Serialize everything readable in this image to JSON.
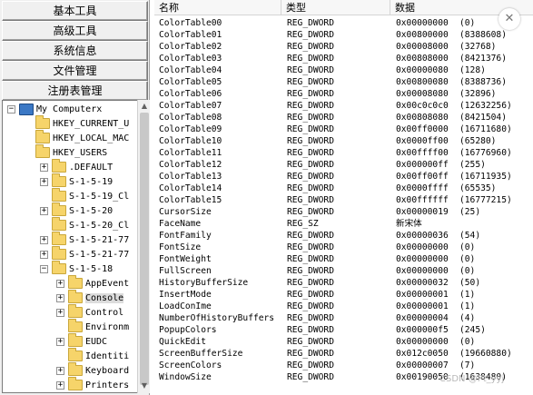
{
  "nav": [
    {
      "label": "基本工具"
    },
    {
      "label": "高级工具"
    },
    {
      "label": "系统信息"
    },
    {
      "label": "文件管理"
    },
    {
      "label": "注册表管理"
    }
  ],
  "tree": [
    {
      "label": "My Computerx",
      "depth": 0,
      "expander": "−",
      "icon": "computer-icon"
    },
    {
      "label": "HKEY_CURRENT_U",
      "depth": 1,
      "expander": "",
      "icon": "folder-icon"
    },
    {
      "label": "HKEY_LOCAL_MAC",
      "depth": 1,
      "expander": "",
      "icon": "folder-icon"
    },
    {
      "label": "HKEY_USERS",
      "depth": 1,
      "expander": "",
      "icon": "folder-icon"
    },
    {
      "label": ".DEFAULT",
      "depth": 2,
      "expander": "+",
      "icon": "folder-icon"
    },
    {
      "label": "S-1-5-19",
      "depth": 2,
      "expander": "+",
      "icon": "folder-icon"
    },
    {
      "label": "S-1-5-19_Cl",
      "depth": 2,
      "expander": "",
      "icon": "folder-icon"
    },
    {
      "label": "S-1-5-20",
      "depth": 2,
      "expander": "+",
      "icon": "folder-icon"
    },
    {
      "label": "S-1-5-20_Cl",
      "depth": 2,
      "expander": "",
      "icon": "folder-icon"
    },
    {
      "label": "S-1-5-21-77",
      "depth": 2,
      "expander": "+",
      "icon": "folder-icon"
    },
    {
      "label": "S-1-5-21-77",
      "depth": 2,
      "expander": "+",
      "icon": "folder-icon"
    },
    {
      "label": "S-1-5-18",
      "depth": 2,
      "expander": "−",
      "icon": "folder-icon"
    },
    {
      "label": "AppEvent",
      "depth": 3,
      "expander": "+",
      "icon": "folder-icon"
    },
    {
      "label": "Console",
      "depth": 3,
      "expander": "+",
      "icon": "folder-icon",
      "selected": true
    },
    {
      "label": "Control",
      "depth": 3,
      "expander": "+",
      "icon": "folder-icon"
    },
    {
      "label": "Environm",
      "depth": 3,
      "expander": "",
      "icon": "folder-icon"
    },
    {
      "label": "EUDC",
      "depth": 3,
      "expander": "+",
      "icon": "folder-icon"
    },
    {
      "label": "Identiti",
      "depth": 3,
      "expander": "",
      "icon": "folder-icon"
    },
    {
      "label": "Keyboard",
      "depth": 3,
      "expander": "+",
      "icon": "folder-icon"
    },
    {
      "label": "Printers",
      "depth": 3,
      "expander": "+",
      "icon": "folder-icon"
    }
  ],
  "columns": {
    "name": "名称",
    "type": "类型",
    "data": "数据"
  },
  "rows": [
    {
      "name": "ColorTable00",
      "type": "REG_DWORD",
      "hex": "0x00000000",
      "dec": "(0)"
    },
    {
      "name": "ColorTable01",
      "type": "REG_DWORD",
      "hex": "0x00800000",
      "dec": "(8388608)"
    },
    {
      "name": "ColorTable02",
      "type": "REG_DWORD",
      "hex": "0x00008000",
      "dec": "(32768)"
    },
    {
      "name": "ColorTable03",
      "type": "REG_DWORD",
      "hex": "0x00808000",
      "dec": "(8421376)"
    },
    {
      "name": "ColorTable04",
      "type": "REG_DWORD",
      "hex": "0x00000080",
      "dec": "(128)"
    },
    {
      "name": "ColorTable05",
      "type": "REG_DWORD",
      "hex": "0x00800080",
      "dec": "(8388736)"
    },
    {
      "name": "ColorTable06",
      "type": "REG_DWORD",
      "hex": "0x00008080",
      "dec": "(32896)"
    },
    {
      "name": "ColorTable07",
      "type": "REG_DWORD",
      "hex": "0x00c0c0c0",
      "dec": "(12632256)"
    },
    {
      "name": "ColorTable08",
      "type": "REG_DWORD",
      "hex": "0x00808080",
      "dec": "(8421504)"
    },
    {
      "name": "ColorTable09",
      "type": "REG_DWORD",
      "hex": "0x00ff0000",
      "dec": "(16711680)"
    },
    {
      "name": "ColorTable10",
      "type": "REG_DWORD",
      "hex": "0x0000ff00",
      "dec": "(65280)"
    },
    {
      "name": "ColorTable11",
      "type": "REG_DWORD",
      "hex": "0x00ffff00",
      "dec": "(16776960)"
    },
    {
      "name": "ColorTable12",
      "type": "REG_DWORD",
      "hex": "0x000000ff",
      "dec": "(255)"
    },
    {
      "name": "ColorTable13",
      "type": "REG_DWORD",
      "hex": "0x00ff00ff",
      "dec": "(16711935)"
    },
    {
      "name": "ColorTable14",
      "type": "REG_DWORD",
      "hex": "0x0000ffff",
      "dec": "(65535)"
    },
    {
      "name": "ColorTable15",
      "type": "REG_DWORD",
      "hex": "0x00ffffff",
      "dec": "(16777215)"
    },
    {
      "name": "CursorSize",
      "type": "REG_DWORD",
      "hex": "0x00000019",
      "dec": "(25)"
    },
    {
      "name": "FaceName",
      "type": "REG_SZ",
      "hex": "新宋体",
      "dec": ""
    },
    {
      "name": "FontFamily",
      "type": "REG_DWORD",
      "hex": "0x00000036",
      "dec": "(54)"
    },
    {
      "name": "FontSize",
      "type": "REG_DWORD",
      "hex": "0x00000000",
      "dec": "(0)"
    },
    {
      "name": "FontWeight",
      "type": "REG_DWORD",
      "hex": "0x00000000",
      "dec": "(0)"
    },
    {
      "name": "FullScreen",
      "type": "REG_DWORD",
      "hex": "0x00000000",
      "dec": "(0)"
    },
    {
      "name": "HistoryBufferSize",
      "type": "REG_DWORD",
      "hex": "0x00000032",
      "dec": "(50)"
    },
    {
      "name": "InsertMode",
      "type": "REG_DWORD",
      "hex": "0x00000001",
      "dec": "(1)"
    },
    {
      "name": "LoadConIme",
      "type": "REG_DWORD",
      "hex": "0x00000001",
      "dec": "(1)"
    },
    {
      "name": "NumberOfHistoryBuffers",
      "type": "REG_DWORD",
      "hex": "0x00000004",
      "dec": "(4)"
    },
    {
      "name": "PopupColors",
      "type": "REG_DWORD",
      "hex": "0x000000f5",
      "dec": "(245)"
    },
    {
      "name": "QuickEdit",
      "type": "REG_DWORD",
      "hex": "0x00000000",
      "dec": "(0)"
    },
    {
      "name": "ScreenBufferSize",
      "type": "REG_DWORD",
      "hex": "0x012c0050",
      "dec": "(19660880)"
    },
    {
      "name": "ScreenColors",
      "type": "REG_DWORD",
      "hex": "0x00000007",
      "dec": "(7)"
    },
    {
      "name": "WindowSize",
      "type": "REG_DWORD",
      "hex": "0x00190050",
      "dec": "(1638480)"
    }
  ],
  "close_glyph": "✕",
  "watermark": "CSDN @Pt_yyj",
  "colors": {
    "folder": "#f6d46a",
    "selection": "#dcdcdc",
    "panel": "#f0f0f0"
  }
}
